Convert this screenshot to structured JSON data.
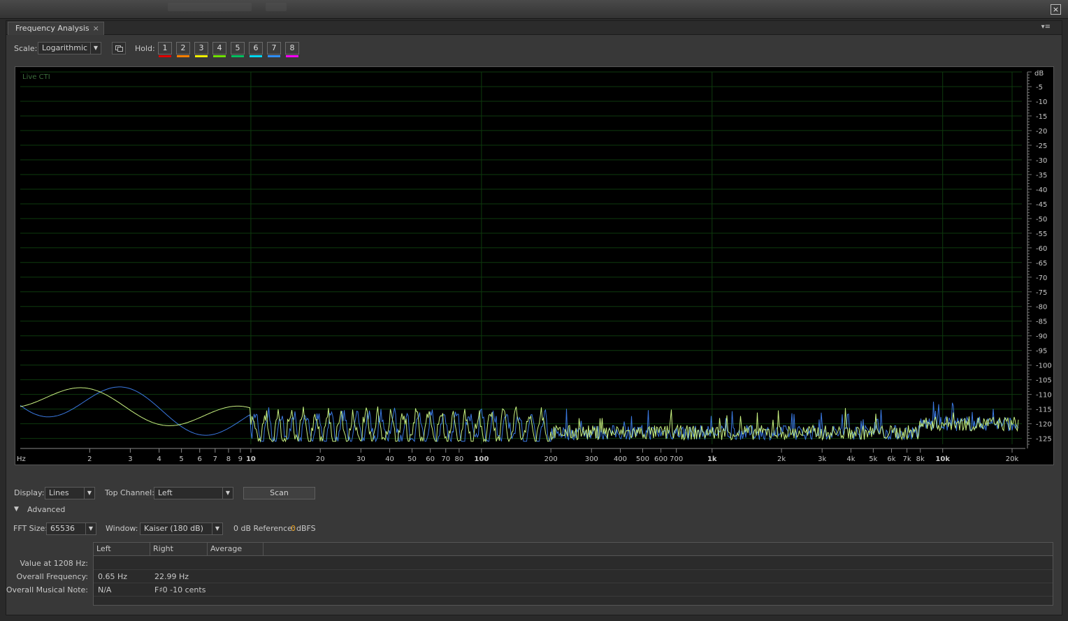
{
  "window": {
    "close_label": "×"
  },
  "panel": {
    "tab_title": "Frequency Analysis",
    "tab_close": "×",
    "menu_glyph": "▾≡"
  },
  "toolbar": {
    "scale_label": "Scale:",
    "scale_value": "Logarithmic",
    "hold_label": "Hold:",
    "holds": [
      {
        "label": "1",
        "color": "#e00000"
      },
      {
        "label": "2",
        "color": "#ff8000"
      },
      {
        "label": "3",
        "color": "#f0f000"
      },
      {
        "label": "4",
        "color": "#70e000"
      },
      {
        "label": "5",
        "color": "#00c060"
      },
      {
        "label": "6",
        "color": "#00d8f0"
      },
      {
        "label": "7",
        "color": "#3090ff"
      },
      {
        "label": "8",
        "color": "#ff00ff"
      }
    ]
  },
  "graph": {
    "live_label": "Live CTI",
    "x_unit": "Hz",
    "y_unit": "dB",
    "x_ticks": [
      {
        "f": 2,
        "label": "2"
      },
      {
        "f": 3,
        "label": "3"
      },
      {
        "f": 4,
        "label": "4"
      },
      {
        "f": 5,
        "label": "5"
      },
      {
        "f": 6,
        "label": "6"
      },
      {
        "f": 7,
        "label": "7"
      },
      {
        "f": 8,
        "label": "8"
      },
      {
        "f": 9,
        "label": "9"
      },
      {
        "f": 10,
        "label": "10",
        "major": true
      },
      {
        "f": 20,
        "label": "20"
      },
      {
        "f": 30,
        "label": "30"
      },
      {
        "f": 40,
        "label": "40"
      },
      {
        "f": 50,
        "label": "50"
      },
      {
        "f": 60,
        "label": "60"
      },
      {
        "f": 70,
        "label": "70"
      },
      {
        "f": 80,
        "label": "80"
      },
      {
        "f": 100,
        "label": "100",
        "major": true
      },
      {
        "f": 200,
        "label": "200"
      },
      {
        "f": 300,
        "label": "300"
      },
      {
        "f": 400,
        "label": "400"
      },
      {
        "f": 500,
        "label": "500"
      },
      {
        "f": 600,
        "label": "600"
      },
      {
        "f": 700,
        "label": "700"
      },
      {
        "f": 1000,
        "label": "1k",
        "major": true
      },
      {
        "f": 2000,
        "label": "2k"
      },
      {
        "f": 3000,
        "label": "3k"
      },
      {
        "f": 4000,
        "label": "4k"
      },
      {
        "f": 5000,
        "label": "5k"
      },
      {
        "f": 6000,
        "label": "6k"
      },
      {
        "f": 7000,
        "label": "7k"
      },
      {
        "f": 8000,
        "label": "8k"
      },
      {
        "f": 10000,
        "label": "10k",
        "major": true
      },
      {
        "f": 20000,
        "label": "20k"
      }
    ],
    "y_ticks": [
      "-5",
      "-10",
      "-15",
      "-20",
      "-25",
      "-30",
      "-35",
      "-40",
      "-45",
      "-50",
      "-55",
      "-60",
      "-65",
      "-70",
      "-75",
      "-80",
      "-85",
      "-90",
      "-95",
      "-100",
      "-105",
      "-110",
      "-115",
      "-120",
      "-125"
    ],
    "grid_color": "#0e3a0e",
    "series_colors": {
      "left": "#3a78e0",
      "right": "#c8f080"
    }
  },
  "controls": {
    "display_label": "Display:",
    "display_value": "Lines",
    "top_channel_label": "Top Channel:",
    "top_channel_value": "Left",
    "scan_label": "Scan",
    "advanced_label": "Advanced",
    "advanced_glyph": "▼",
    "fft_label": "FFT Size:",
    "fft_value": "65536",
    "window_label": "Window:",
    "window_value": "Kaiser (180 dB)",
    "ref_label": "0 dB Reference:",
    "ref_value": "0",
    "ref_unit": "dBFS"
  },
  "results": {
    "columns": [
      "Left",
      "Right",
      "Average"
    ],
    "rows": [
      {
        "label": "Value at 1208 Hz:",
        "left": "",
        "right": ""
      },
      {
        "label": "Overall Frequency:",
        "left": "0.65 Hz",
        "right": "22.99 Hz"
      },
      {
        "label": "Overall Musical Note:",
        "left": "N/A",
        "right": "F♯0 -10 cents"
      }
    ]
  }
}
